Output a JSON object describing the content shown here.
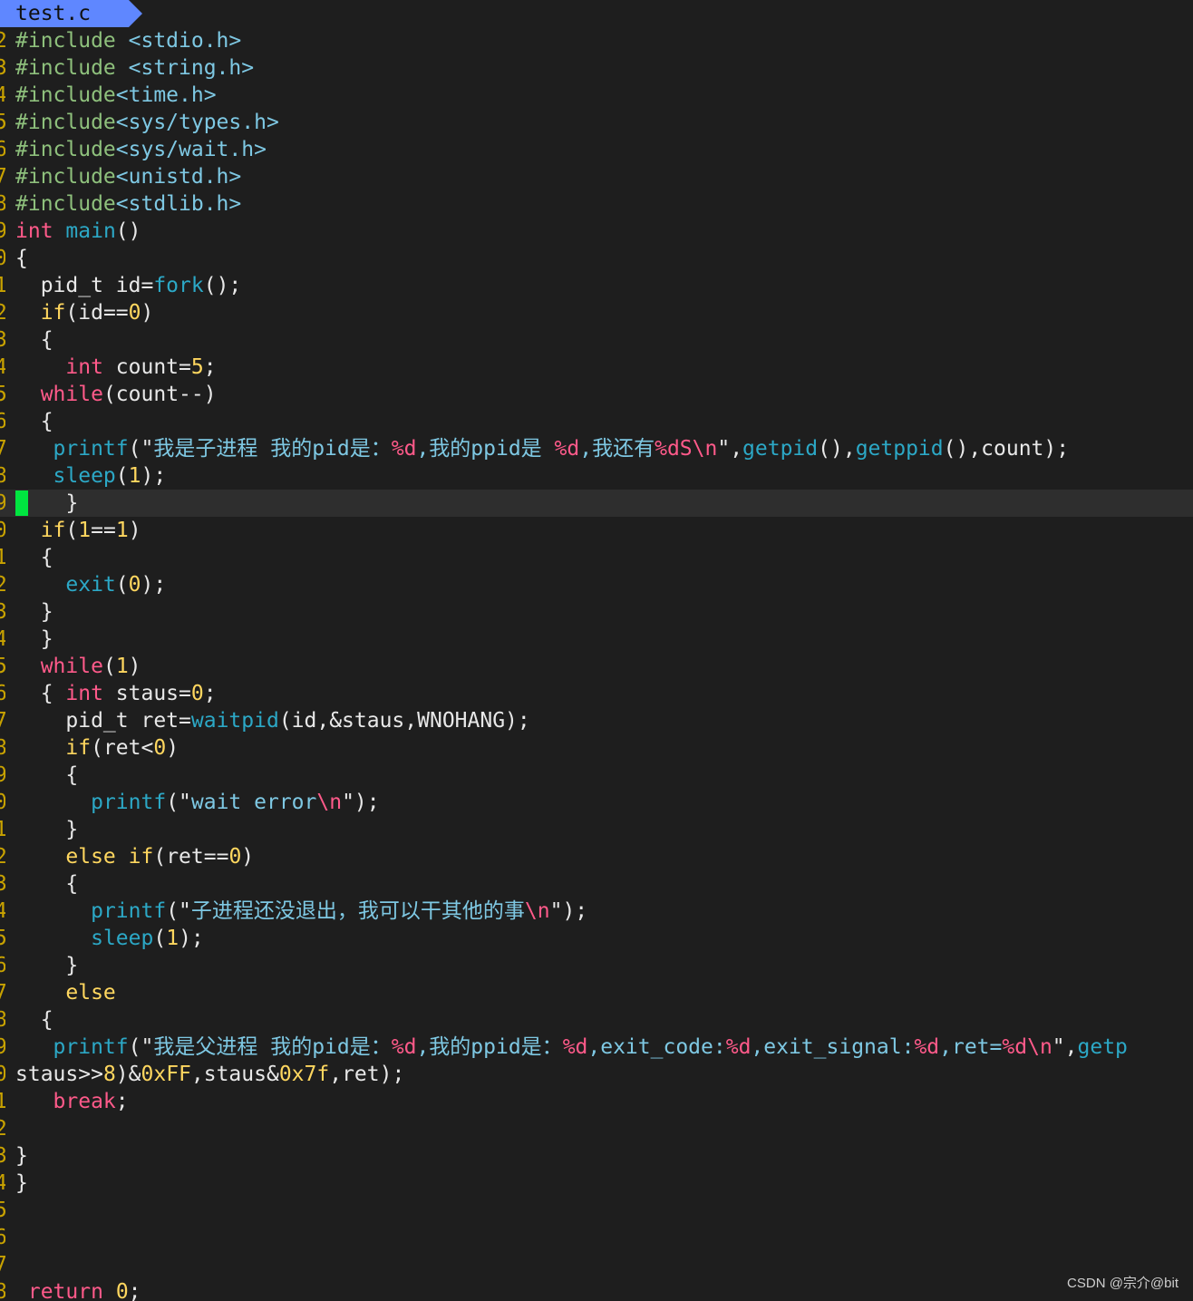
{
  "tab": {
    "filename": "test.c"
  },
  "colors": {
    "background": "#1e1e1e",
    "tab_background": "#5f87ff",
    "cursor": "#00e640",
    "cursorline": "#2e2e2e",
    "keyword": "#ff5a8a",
    "control": "#ffd75f",
    "function": "#2ca8c6",
    "string": "#7ec8e3",
    "preproc": "#8ec07c"
  },
  "editor": {
    "current_line_index": 17,
    "lines": [
      [
        [
          "#include ",
          "pre"
        ],
        [
          "<stdio.h>",
          "inc"
        ]
      ],
      [
        [
          "#include ",
          "pre"
        ],
        [
          "<string.h>",
          "inc"
        ]
      ],
      [
        [
          "#include",
          "pre"
        ],
        [
          "<time.h>",
          "inc"
        ]
      ],
      [
        [
          "#include",
          "pre"
        ],
        [
          "<sys/types.h>",
          "inc"
        ]
      ],
      [
        [
          "#include",
          "pre"
        ],
        [
          "<sys/wait.h>",
          "inc"
        ]
      ],
      [
        [
          "#include",
          "pre"
        ],
        [
          "<unistd.h>",
          "inc"
        ]
      ],
      [
        [
          "#include",
          "pre"
        ],
        [
          "<stdlib.h>",
          "inc"
        ]
      ],
      [
        [
          "int",
          "type"
        ],
        [
          " ",
          "punc"
        ],
        [
          "main",
          "fn"
        ],
        [
          "()",
          "punc"
        ]
      ],
      [
        [
          "{",
          "punc"
        ]
      ],
      [
        [
          "  pid_t id=",
          "punc"
        ],
        [
          "fork",
          "fn"
        ],
        [
          "();",
          "punc"
        ]
      ],
      [
        [
          "  ",
          "punc"
        ],
        [
          "if",
          "ctl"
        ],
        [
          "(id==",
          "punc"
        ],
        [
          "0",
          "num"
        ],
        [
          ")",
          "punc"
        ]
      ],
      [
        [
          "  {",
          "punc"
        ]
      ],
      [
        [
          "    ",
          "punc"
        ],
        [
          "int",
          "type"
        ],
        [
          " count=",
          "punc"
        ],
        [
          "5",
          "num"
        ],
        [
          ";",
          "punc"
        ]
      ],
      [
        [
          "  ",
          "punc"
        ],
        [
          "while",
          "kw"
        ],
        [
          "(count--)",
          "punc"
        ]
      ],
      [
        [
          "  {",
          "punc"
        ]
      ],
      [
        [
          "   ",
          "punc"
        ],
        [
          "printf",
          "fn"
        ],
        [
          "(\"",
          "punc"
        ],
        [
          "我是子进程 我的pid是：",
          "str"
        ],
        [
          "%d",
          "fmt"
        ],
        [
          ",我的ppid是 ",
          "str"
        ],
        [
          "%d",
          "fmt"
        ],
        [
          ",我还有",
          "str"
        ],
        [
          "%dS",
          "fmt"
        ],
        [
          "\\n",
          "esc"
        ],
        [
          "\",",
          "punc"
        ],
        [
          "getpid",
          "fn"
        ],
        [
          "(),",
          "punc"
        ],
        [
          "getppid",
          "fn"
        ],
        [
          "(),count);",
          "punc"
        ]
      ],
      [
        [
          "   ",
          "punc"
        ],
        [
          "sleep",
          "fn"
        ],
        [
          "(",
          "punc"
        ],
        [
          "1",
          "num"
        ],
        [
          ");",
          "punc"
        ]
      ],
      [
        [
          "cursor",
          "cursor"
        ],
        [
          "   }",
          "punc"
        ]
      ],
      [
        [
          "  ",
          "punc"
        ],
        [
          "if",
          "ctl"
        ],
        [
          "(",
          "punc"
        ],
        [
          "1",
          "num"
        ],
        [
          "==",
          "punc"
        ],
        [
          "1",
          "num"
        ],
        [
          ")",
          "punc"
        ]
      ],
      [
        [
          "  {",
          "punc"
        ]
      ],
      [
        [
          "    ",
          "punc"
        ],
        [
          "exit",
          "fn"
        ],
        [
          "(",
          "punc"
        ],
        [
          "0",
          "num"
        ],
        [
          ");",
          "punc"
        ]
      ],
      [
        [
          "  }",
          "punc"
        ]
      ],
      [
        [
          "  }",
          "punc"
        ]
      ],
      [
        [
          "  ",
          "punc"
        ],
        [
          "while",
          "kw"
        ],
        [
          "(",
          "punc"
        ],
        [
          "1",
          "num"
        ],
        [
          ")",
          "punc"
        ]
      ],
      [
        [
          "  { ",
          "punc"
        ],
        [
          "int",
          "type"
        ],
        [
          " staus=",
          "punc"
        ],
        [
          "0",
          "num"
        ],
        [
          ";",
          "punc"
        ]
      ],
      [
        [
          "    pid_t ret=",
          "punc"
        ],
        [
          "waitpid",
          "fn"
        ],
        [
          "(id,&staus,WNOHANG);",
          "punc"
        ]
      ],
      [
        [
          "    ",
          "punc"
        ],
        [
          "if",
          "ctl"
        ],
        [
          "(ret<",
          "punc"
        ],
        [
          "0",
          "num"
        ],
        [
          ")",
          "punc"
        ]
      ],
      [
        [
          "    {",
          "punc"
        ]
      ],
      [
        [
          "      ",
          "punc"
        ],
        [
          "printf",
          "fn"
        ],
        [
          "(\"",
          "punc"
        ],
        [
          "wait error",
          "str"
        ],
        [
          "\\n",
          "esc"
        ],
        [
          "\");",
          "punc"
        ]
      ],
      [
        [
          "    }",
          "punc"
        ]
      ],
      [
        [
          "    ",
          "punc"
        ],
        [
          "else",
          "ctl"
        ],
        [
          " ",
          "punc"
        ],
        [
          "if",
          "ctl"
        ],
        [
          "(ret==",
          "punc"
        ],
        [
          "0",
          "num"
        ],
        [
          ")",
          "punc"
        ]
      ],
      [
        [
          "    {",
          "punc"
        ]
      ],
      [
        [
          "      ",
          "punc"
        ],
        [
          "printf",
          "fn"
        ],
        [
          "(\"",
          "punc"
        ],
        [
          "子进程还没退出，我可以干其他的事",
          "str"
        ],
        [
          "\\n",
          "esc"
        ],
        [
          "\");",
          "punc"
        ]
      ],
      [
        [
          "      ",
          "punc"
        ],
        [
          "sleep",
          "fn"
        ],
        [
          "(",
          "punc"
        ],
        [
          "1",
          "num"
        ],
        [
          ");",
          "punc"
        ]
      ],
      [
        [
          "    }",
          "punc"
        ]
      ],
      [
        [
          "    ",
          "punc"
        ],
        [
          "else",
          "ctl"
        ]
      ],
      [
        [
          "  {",
          "punc"
        ]
      ],
      [
        [
          "   ",
          "punc"
        ],
        [
          "printf",
          "fn"
        ],
        [
          "(\"",
          "punc"
        ],
        [
          "我是父进程 我的pid是：",
          "str"
        ],
        [
          "%d",
          "fmt"
        ],
        [
          ",我的ppid是：",
          "str"
        ],
        [
          "%d",
          "fmt"
        ],
        [
          ",exit_code:",
          "str"
        ],
        [
          "%d",
          "fmt"
        ],
        [
          ",exit_signal:",
          "str"
        ],
        [
          "%d",
          "fmt"
        ],
        [
          ",ret=",
          "str"
        ],
        [
          "%d",
          "fmt"
        ],
        [
          "\\n",
          "esc"
        ],
        [
          "\",",
          "punc"
        ],
        [
          "getp",
          "fn"
        ]
      ],
      [
        [
          "staus>>",
          "punc"
        ],
        [
          "8",
          "num"
        ],
        [
          ")&",
          "punc"
        ],
        [
          "0xFF",
          "num"
        ],
        [
          ",staus&",
          "punc"
        ],
        [
          "0x7f",
          "num"
        ],
        [
          ",ret);",
          "punc"
        ]
      ],
      [
        [
          "   ",
          "punc"
        ],
        [
          "break",
          "kw"
        ],
        [
          ";",
          "punc"
        ]
      ],
      [
        [
          "",
          "punc"
        ]
      ],
      [
        [
          "}",
          "punc"
        ]
      ],
      [
        [
          "}",
          "punc"
        ]
      ],
      [
        [
          "",
          "punc"
        ]
      ],
      [
        [
          "",
          "punc"
        ]
      ],
      [
        [
          "",
          "punc"
        ]
      ],
      [
        [
          " ",
          "punc"
        ],
        [
          "return",
          "kw"
        ],
        [
          " ",
          "punc"
        ],
        [
          "0",
          "num"
        ],
        [
          ";",
          "punc"
        ]
      ]
    ]
  },
  "watermark": "CSDN @宗介@bit"
}
